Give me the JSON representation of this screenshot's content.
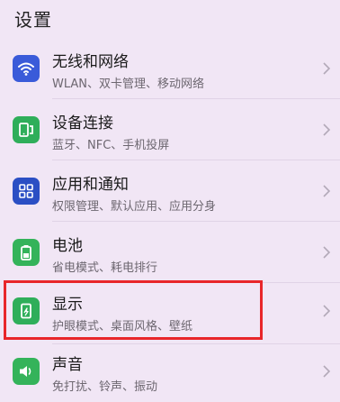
{
  "page": {
    "title": "设置"
  },
  "items": [
    {
      "title": "无线和网络",
      "subtitle": "WLAN、双卡管理、移动网络",
      "icon": "wifi-icon",
      "icon_color": "#3a5bd9"
    },
    {
      "title": "设备连接",
      "subtitle": "蓝牙、NFC、手机投屏",
      "icon": "device-connect-icon",
      "icon_color": "#2fae5a"
    },
    {
      "title": "应用和通知",
      "subtitle": "权限管理、默认应用、应用分身",
      "icon": "apps-grid-icon",
      "icon_color": "#2b4fc4"
    },
    {
      "title": "电池",
      "subtitle": "省电模式、耗电排行",
      "icon": "battery-icon",
      "icon_color": "#34b35a"
    },
    {
      "title": "显示",
      "subtitle": "护眼模式、桌面风格、壁纸",
      "icon": "display-icon",
      "icon_color": "#2fae5a"
    },
    {
      "title": "声音",
      "subtitle": "免打扰、铃声、振动",
      "icon": "speaker-icon",
      "icon_color": "#34b35a"
    }
  ],
  "colors": {
    "background": "#f1e6f5",
    "highlight": "#e8262a"
  }
}
